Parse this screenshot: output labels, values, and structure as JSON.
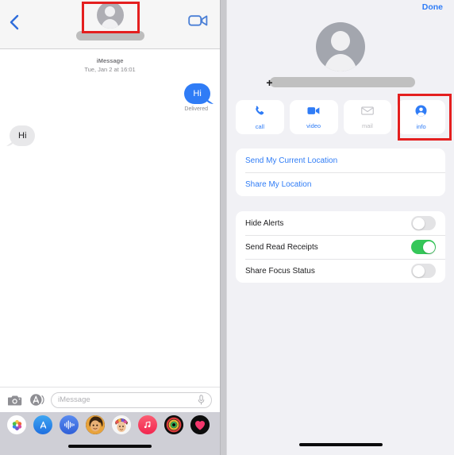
{
  "conversation": {
    "back_icon": "chevron-left-icon",
    "facetime_icon": "video-camera-icon",
    "contact_name_redacted": "",
    "thread": {
      "service": "iMessage",
      "timestamp": "Tue, Jan 2 at 16:01",
      "messages": [
        {
          "text": "Hi",
          "direction": "outgoing",
          "status": "Delivered"
        },
        {
          "text": "Hi",
          "direction": "incoming",
          "status": ""
        }
      ]
    },
    "compose": {
      "camera_icon": "camera-icon",
      "apps_icon": "app-store-icon",
      "placeholder": "iMessage",
      "value": "",
      "mic_icon": "microphone-icon"
    },
    "app_drawer": [
      {
        "name": "photos-app-icon",
        "color": "#ffffff"
      },
      {
        "name": "app-store-icon",
        "color": "#2f7cf6"
      },
      {
        "name": "audio-message-icon",
        "color": "#3a6ee8"
      },
      {
        "name": "memoji-one-icon",
        "color": "#3a2a16"
      },
      {
        "name": "memoji-two-icon",
        "color": "#f2f2f2"
      },
      {
        "name": "music-app-icon",
        "color": "#f5395b"
      },
      {
        "name": "digital-touch-icon",
        "color": "#111111"
      },
      {
        "name": "heart-app-icon",
        "color": "#111111"
      }
    ]
  },
  "details": {
    "done_label": "Done",
    "phone_prefix": "+",
    "phone_redacted": "",
    "actions": [
      {
        "label": "call",
        "icon": "phone-icon",
        "enabled": true,
        "highlighted": false
      },
      {
        "label": "video",
        "icon": "video-camera-icon",
        "enabled": true,
        "highlighted": false
      },
      {
        "label": "mail",
        "icon": "envelope-icon",
        "enabled": false,
        "highlighted": false
      },
      {
        "label": "info",
        "icon": "person-circle-icon",
        "enabled": true,
        "highlighted": true
      }
    ],
    "location_rows": [
      {
        "label": "Send My Current Location"
      },
      {
        "label": "Share My Location"
      }
    ],
    "switch_rows": [
      {
        "label": "Hide Alerts",
        "value": false
      },
      {
        "label": "Send Read Receipts",
        "value": true
      },
      {
        "label": "Share Focus Status",
        "value": false
      }
    ]
  },
  "colors": {
    "accent_blue": "#2f7cf6",
    "toggle_green": "#35c759",
    "highlight_red": "#e41f1f",
    "bubble_incoming": "#e8e8ea",
    "page_background": "#f1f1f5"
  }
}
